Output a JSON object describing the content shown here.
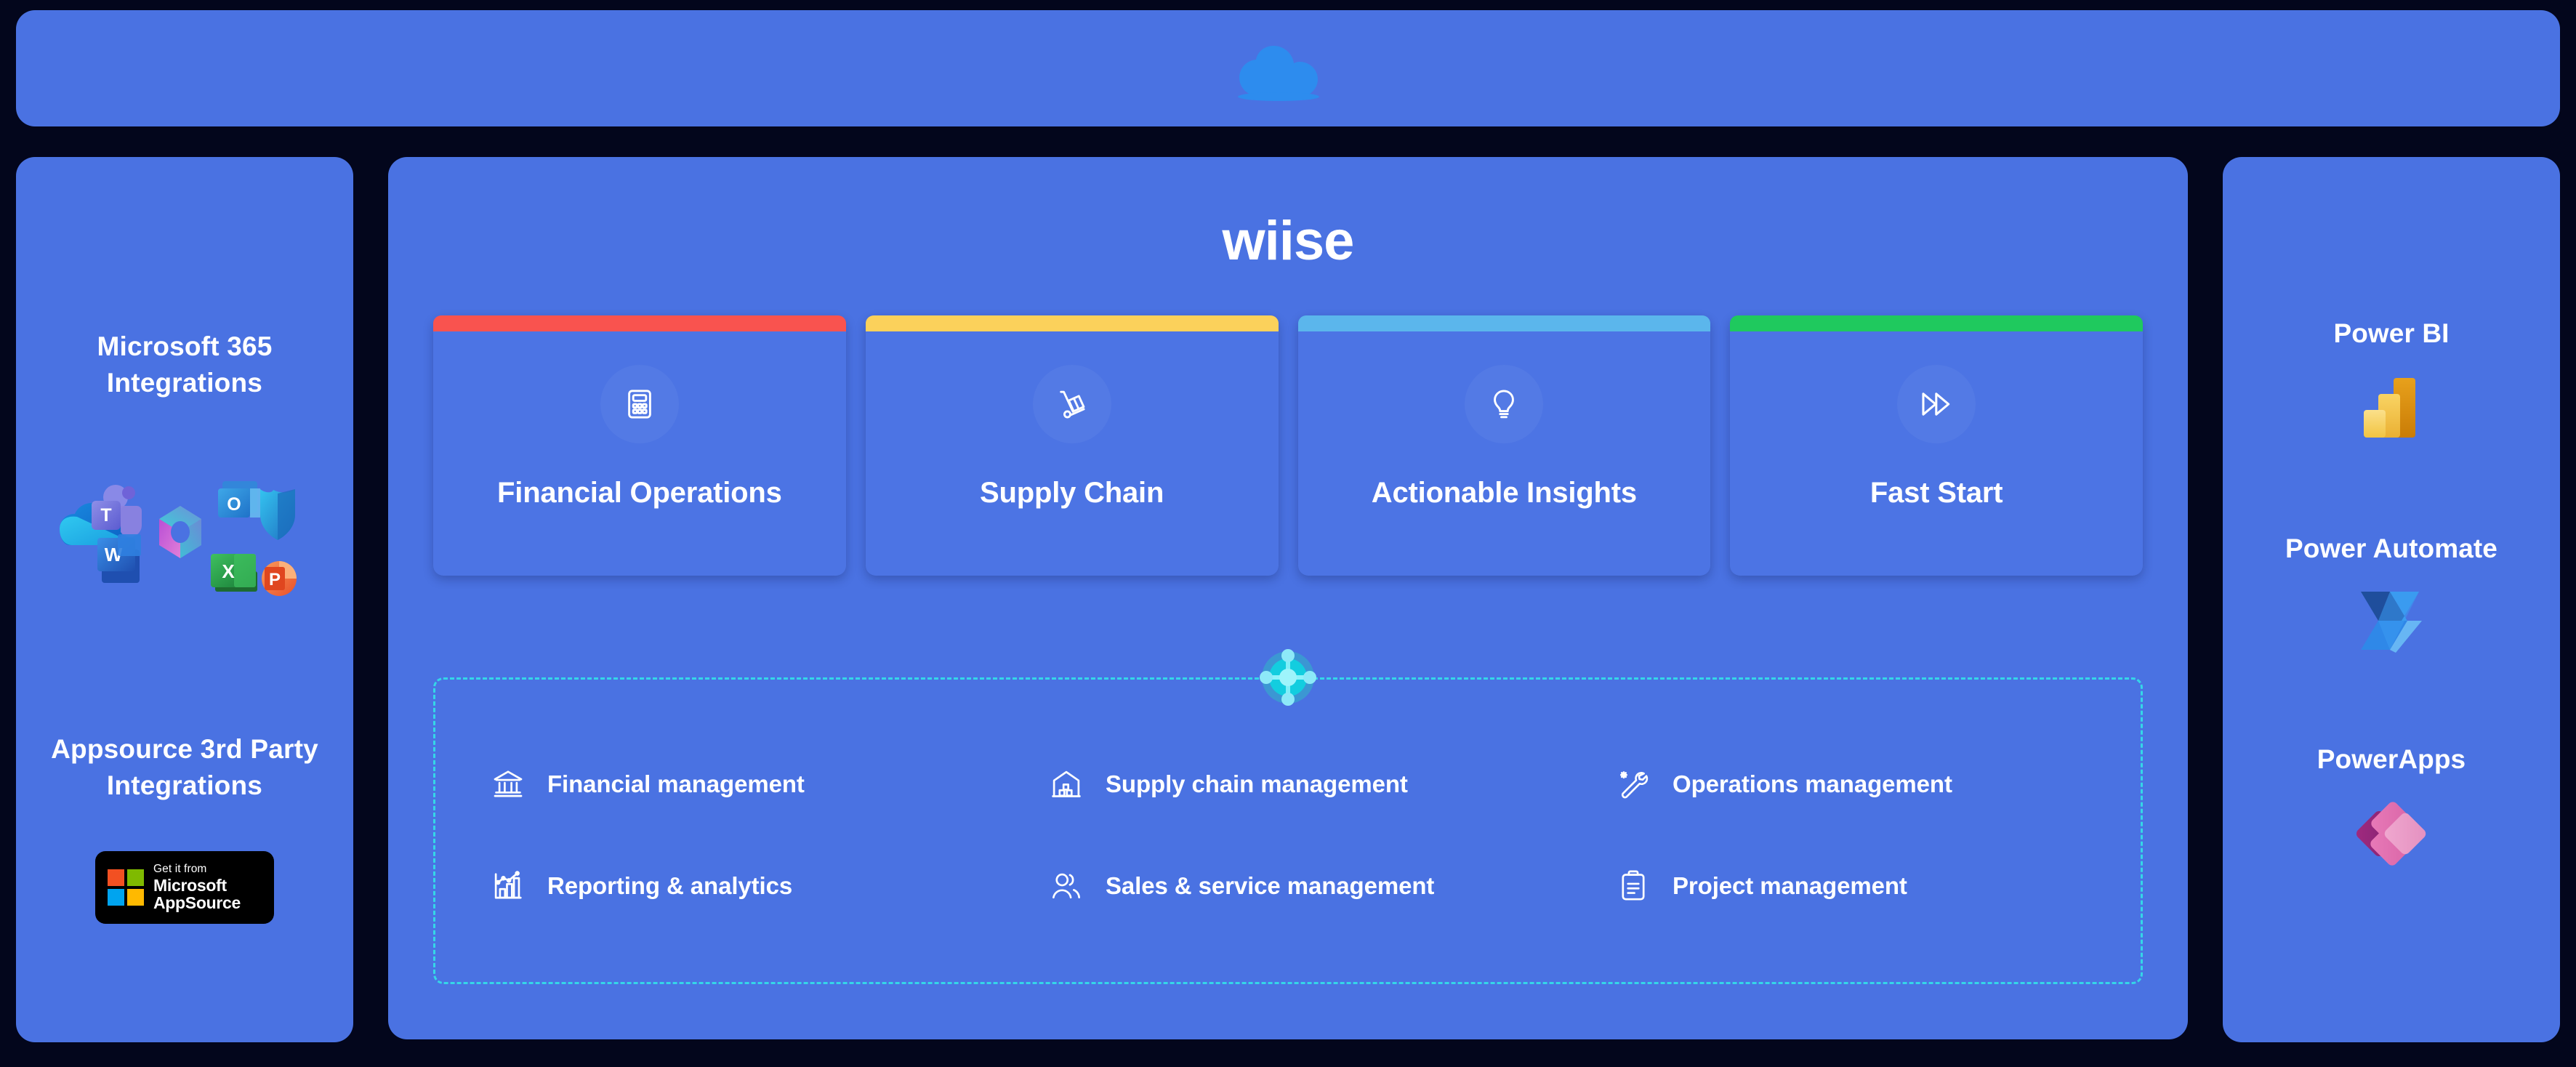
{
  "top_banner": {
    "icon": "cloud-icon"
  },
  "left_panel": {
    "ms365_title": "Microsoft 365 Integrations",
    "ms365_icons": [
      "onedrive-icon",
      "teams-icon",
      "office-icon",
      "outlook-icon",
      "defender-icon",
      "word-icon",
      "excel-icon",
      "powerpoint-icon"
    ],
    "appsource_title": "Appsource 3rd Party Integrations",
    "appsource_badge": {
      "line1": "Get it from",
      "line2": "Microsoft",
      "line3": "AppSource",
      "icon": "microsoft-logo-icon",
      "colors": {
        "red": "#f25022",
        "green": "#7fba00",
        "blue": "#00a4ef",
        "yellow": "#ffb900"
      }
    }
  },
  "center_panel": {
    "logo": "wiise",
    "cards": [
      {
        "label": "Financial Operations",
        "icon": "calculator-icon",
        "accent": "#f9534f"
      },
      {
        "label": "Supply Chain",
        "icon": "hand-truck-icon",
        "accent": "#fbd15b"
      },
      {
        "label": "Actionable Insights",
        "icon": "lightbulb-icon",
        "accent": "#5bb6ec"
      },
      {
        "label": "Fast Start",
        "icon": "fast-forward-icon",
        "accent": "#1fc95e"
      }
    ],
    "hub_icon": "network-hub-icon",
    "feature_box_border_color": "#35d6e8",
    "features": [
      {
        "label": "Financial management",
        "icon": "bank-icon"
      },
      {
        "label": "Supply chain management",
        "icon": "warehouse-icon"
      },
      {
        "label": "Operations management",
        "icon": "wrench-gear-icon"
      },
      {
        "label": "Reporting & analytics",
        "icon": "bar-chart-icon"
      },
      {
        "label": "Sales & service management",
        "icon": "people-icon"
      },
      {
        "label": "Project management",
        "icon": "clipboard-icon"
      }
    ]
  },
  "right_panel": {
    "items": [
      {
        "title": "Power BI",
        "icon": "power-bi-icon"
      },
      {
        "title": "Power Automate",
        "icon": "power-automate-icon"
      },
      {
        "title": "PowerApps",
        "icon": "powerapps-icon"
      }
    ]
  },
  "theme": {
    "background": "#03061c",
    "panel_blue": "#4a72e2",
    "card_blue": "#4c74e4",
    "cloud_blue": "#2d8cee",
    "text_white": "#ffffff"
  }
}
